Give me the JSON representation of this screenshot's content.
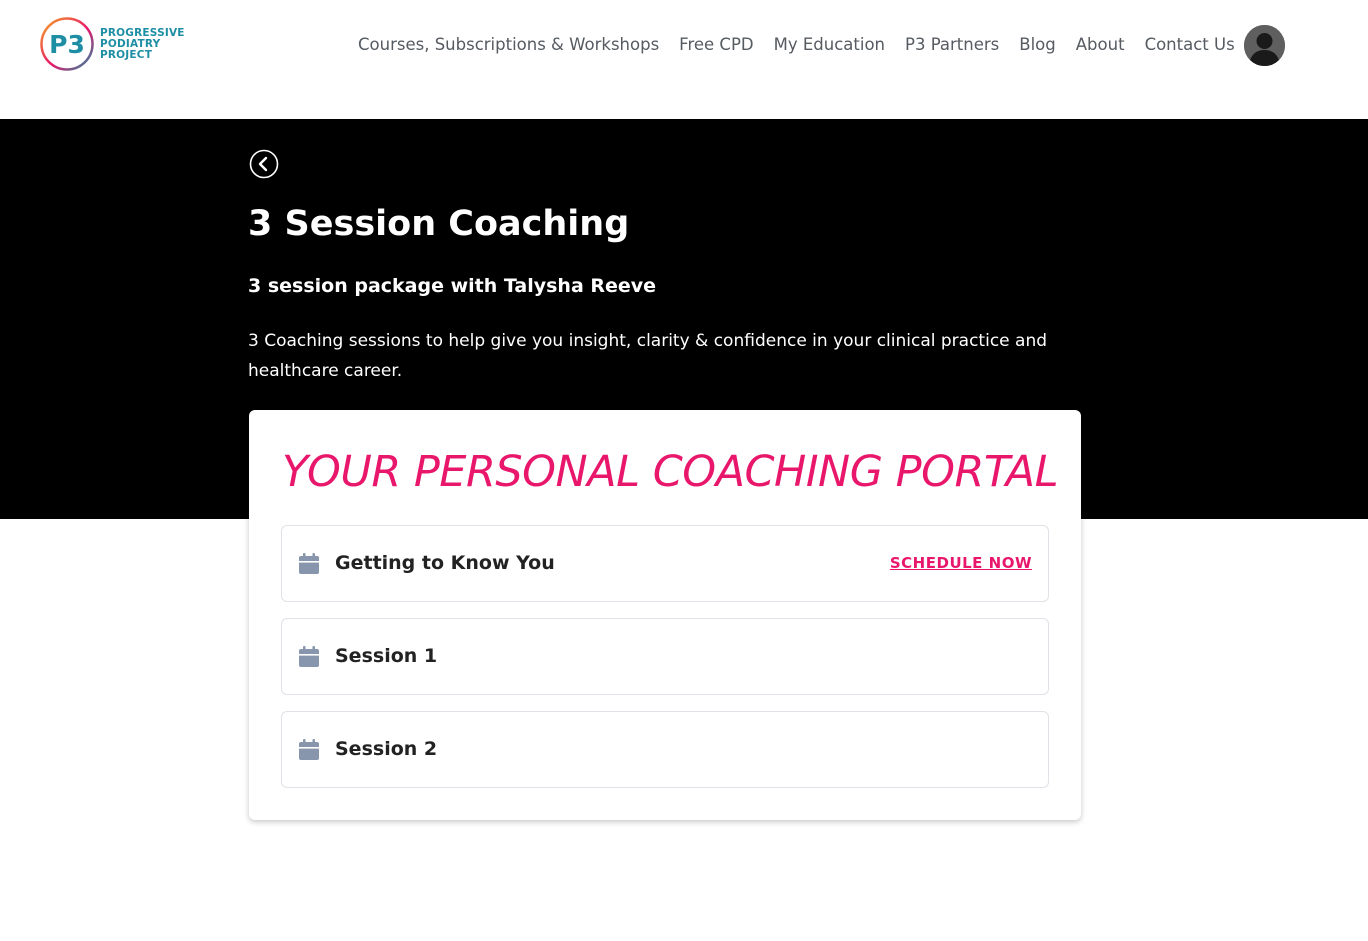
{
  "brand": {
    "logo_mark": "P3",
    "logo_lines": [
      "PROGRESSIVE",
      "PODIATRY",
      "PROJECT"
    ],
    "colors": {
      "teal": "#1d8ea4",
      "orange": "#f5a623",
      "pink": "#e8176b"
    }
  },
  "nav": {
    "items": [
      {
        "label": "Courses, Subscriptions & Workshops"
      },
      {
        "label": "Free CPD"
      },
      {
        "label": "My Education"
      },
      {
        "label": "P3 Partners"
      },
      {
        "label": "Blog"
      },
      {
        "label": "About"
      },
      {
        "label": "Contact Us"
      }
    ],
    "avatar_icon": "user-avatar-icon"
  },
  "hero": {
    "back_icon": "chevron-left-circle-icon",
    "title": "3 Session Coaching",
    "subtitle": "3 session package with Talysha Reeve",
    "description": "3 Coaching sessions to help give you insight, clarity & confidence in your clinical practice and healthcare career."
  },
  "portal": {
    "title": "YOUR PERSONAL COACHING PORTAL",
    "accent_color": "#e8176b",
    "sessions": [
      {
        "name": "Getting to Know You",
        "action": "SCHEDULE NOW",
        "icon": "calendar-icon"
      },
      {
        "name": "Session 1",
        "action": "",
        "icon": "calendar-icon"
      },
      {
        "name": "Session 2",
        "action": "",
        "icon": "calendar-icon"
      }
    ]
  }
}
